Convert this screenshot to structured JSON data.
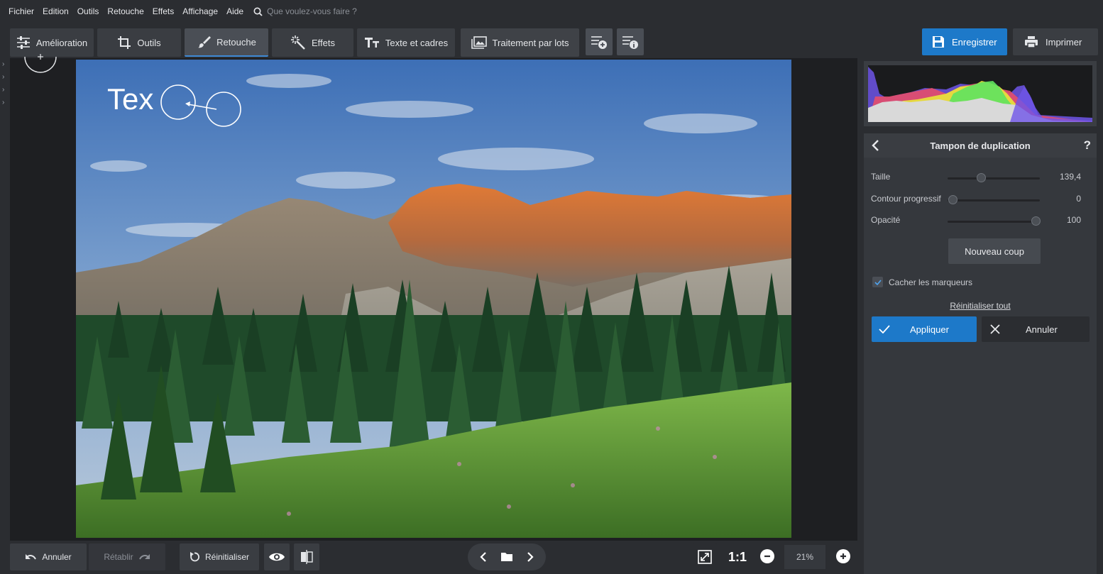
{
  "menu": {
    "items": [
      "Fichier",
      "Edition",
      "Outils",
      "Retouche",
      "Effets",
      "Affichage",
      "Aide"
    ],
    "search_placeholder": "Que voulez-vous faire ?"
  },
  "tabs": {
    "amelioration": "Amélioration",
    "outils": "Outils",
    "retouche": "Retouche",
    "effets": "Effets",
    "texte": "Texte et cadres",
    "lots": "Traitement par lots"
  },
  "actions": {
    "save": "Enregistrer",
    "print": "Imprimer"
  },
  "canvas": {
    "overlay_text": "Tex"
  },
  "panel": {
    "title": "Tampon de duplication",
    "help": "?",
    "sliders": [
      {
        "label": "Taille",
        "value": "139,4",
        "level": 0.36
      },
      {
        "label": "Contour progressif",
        "value": "0",
        "level": 0.0
      },
      {
        "label": "Opacité",
        "value": "100",
        "level": 1.0
      }
    ],
    "new_stroke": "Nouveau coup",
    "hide_markers": "Cacher les marqueurs",
    "hide_markers_checked": true,
    "reset_all": "Réinitialiser tout",
    "apply": "Appliquer",
    "cancel": "Annuler"
  },
  "bottom": {
    "undo": "Annuler",
    "redo": "Rétablir",
    "reset": "Réinitialiser",
    "ratio": "1:1",
    "zoom": "21%"
  },
  "colors": {
    "accent": "#1d79c9",
    "background": "#2b2d31"
  }
}
